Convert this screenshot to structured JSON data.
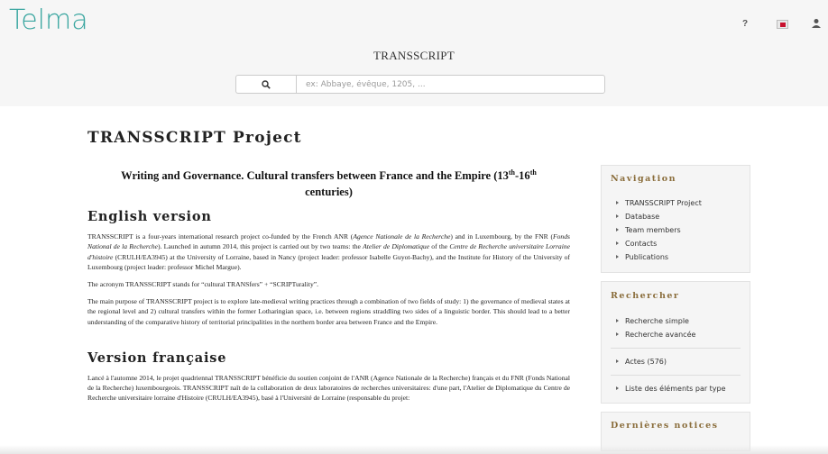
{
  "header": {
    "logo_text": "Telma",
    "help_label": "?",
    "site_title": "TRANSSCRIPT",
    "search": {
      "placeholder": "ex: Abbaye, évêque, 1205, ..."
    }
  },
  "page": {
    "title": "TRANSSCRIPT Project",
    "subtitle_pre": "Writing and Governance. Cultural transfers between France and the Empire (13",
    "subtitle_sup1": "th",
    "subtitle_mid": "-16",
    "subtitle_sup2": "th",
    "subtitle_post": " centuries)",
    "english_heading": "English version",
    "english_p1_a": "TRANSSCRIPT is a four-years international research project co-funded by the French ANR (",
    "english_p1_b": "Agence Nationale de la Recherche",
    "english_p1_c": ") and in Luxembourg, by the FNR (",
    "english_p1_d": "Fonds National de la Recherche",
    "english_p1_e": "). Launched in autumn 2014, this project is carried out by two teams: the ",
    "english_p1_f": "Atelier de Diplomatique",
    "english_p1_g": " of the ",
    "english_p1_h": "Centre de Recherche universitaire Lorraine d'histoire",
    "english_p1_i": " (CRULH/EA3945) at the University of Lorraine, based in Nancy (project leader: professor Isabelle Guyot-Bachy), and the Institute for History of the University of Luxembourg (project leader: professor Michel Margue).",
    "english_p2": "The acronym TRANSSCRIPT stands for “cultural TRANSfers” + “SCRIPTurality”.",
    "english_p3": "The main purpose of TRANSSCRIPT project is to explore late-medieval writing practices through a combination of two fields of study: 1) the governance of medieval states at the regional level and 2) cultural transfers within the former Lotharingian space, i.e. between regions straddling two sides of a linguistic border. This should lead to a better understanding of the comparative history of territorial principalities in the northern border area between France and the Empire.",
    "french_heading": "Version française",
    "french_p1": "Lancé à l'automne 2014, le projet quadriennal TRANSSCRIPT bénéficie du soutien conjoint de l'ANR (Agence Nationale de la Recherche) français et du FNR (Fonds National de la Recherche) luxembourgeois. TRANSSCRIPT naît de la collaboration de deux laboratoires de recherches universitaires: d'une part, l'Atelier de Diplomatique du Centre de Recherche universitaire lorraine d'Histoire (CRULH/EA3945), basé à l'Université de Lorraine (responsable du projet:"
  },
  "sidebar": {
    "navigation": {
      "title": "Navigation",
      "items": [
        "TRANSSCRIPT Project",
        "Database",
        "Team members",
        "Contacts",
        "Publications"
      ]
    },
    "rechercher": {
      "title": "Rechercher",
      "items": [
        "Recherche simple",
        "Recherche avancée"
      ],
      "actes": "Actes (576)",
      "liste": "Liste des éléments par type"
    },
    "notices": {
      "title": "Dernières notices"
    }
  },
  "colors": {
    "accent": "#8a6d3b",
    "flag_red": "#c8102e",
    "logo_teal": "#3aa6a0"
  }
}
